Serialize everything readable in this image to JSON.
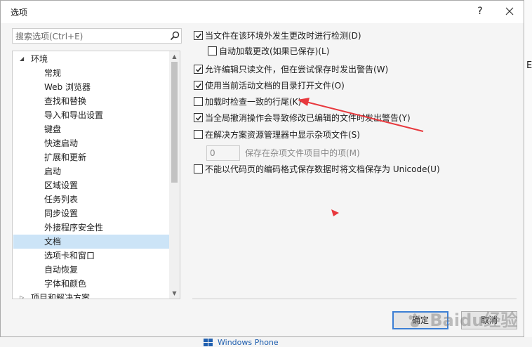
{
  "window": {
    "title": "选项",
    "help_label": "?"
  },
  "search": {
    "placeholder": "搜索选项(Ctrl+E)"
  },
  "tree": {
    "root": "环境",
    "items": [
      "常规",
      "Web 浏览器",
      "查找和替换",
      "导入和导出设置",
      "键盘",
      "快速启动",
      "扩展和更新",
      "启动",
      "区域设置",
      "任务列表",
      "同步设置",
      "外接程序安全性",
      "文档",
      "选项卡和窗口",
      "自动恢复",
      "字体和颜色"
    ],
    "next_root": "项目和解决方案",
    "selected": "文档"
  },
  "options": {
    "detect_external_changes": {
      "label": "当文件在该环境外发生更改时进行检测(D)",
      "checked": true
    },
    "auto_load_changes": {
      "label": "自动加载更改(如果已保存)(L)",
      "checked": false
    },
    "allow_edit_readonly": {
      "label": "允许编辑只读文件，但在尝试保存时发出警告(W)",
      "checked": true
    },
    "open_in_current_dir": {
      "label": "使用当前活动文档的目录打开文件(O)",
      "checked": true
    },
    "check_line_endings": {
      "label": "加载时检查一致的行尾(K)",
      "checked": false
    },
    "warn_global_undo": {
      "label": "当全局撤消操作会导致修改已编辑的文件时发出警告(Y)",
      "checked": true
    },
    "show_misc_files": {
      "label": "在解决方案资源管理器中显示杂项文件(S)",
      "checked": false
    },
    "misc_items_value": "0",
    "misc_items_label": "保存在杂项文件项目中的项(M)",
    "save_as_unicode": {
      "label": "不能以代码页的编码格式保存数据时将文档保存为 Unicode(U)",
      "checked": false
    }
  },
  "buttons": {
    "ok": "确定",
    "cancel": "取消"
  },
  "background": {
    "right_letter": "E",
    "taskbar_text": "Windows Phone"
  },
  "watermark": {
    "text": "Baidu经验"
  },
  "colors": {
    "annotation_red": "#e8383d",
    "selection": "#cce4f7",
    "accent_blue": "#3c7fd4"
  }
}
